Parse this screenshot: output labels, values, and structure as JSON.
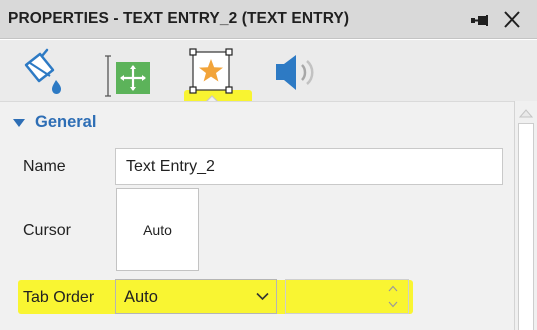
{
  "panel": {
    "title": "PROPERTIES - TEXT ENTRY_2 (TEXT ENTRY)",
    "pin_icon": "pin-icon",
    "close_icon": "close-icon"
  },
  "toolbar": {
    "tabs": [
      {
        "name": "style",
        "icon": "paint-bucket-icon"
      },
      {
        "name": "size-and-position",
        "icon": "move-resize-icon"
      },
      {
        "name": "actions",
        "icon": "star-icon",
        "selected": true
      },
      {
        "name": "audio",
        "icon": "speaker-icon"
      }
    ]
  },
  "section": {
    "title": "General",
    "expanded": true
  },
  "fields": {
    "name_label": "Name",
    "name_value": "Text Entry_2",
    "cursor_label": "Cursor",
    "cursor_value": "Auto",
    "tab_order_label": "Tab Order",
    "tab_order_value": "Auto",
    "tab_order_number": ""
  },
  "colors": {
    "highlight": "#faf507",
    "accent": "#2e6eb5",
    "titlebar": "#d9d9d9",
    "toolbar": "#ebebeb",
    "panel": "#f1f1f1"
  }
}
